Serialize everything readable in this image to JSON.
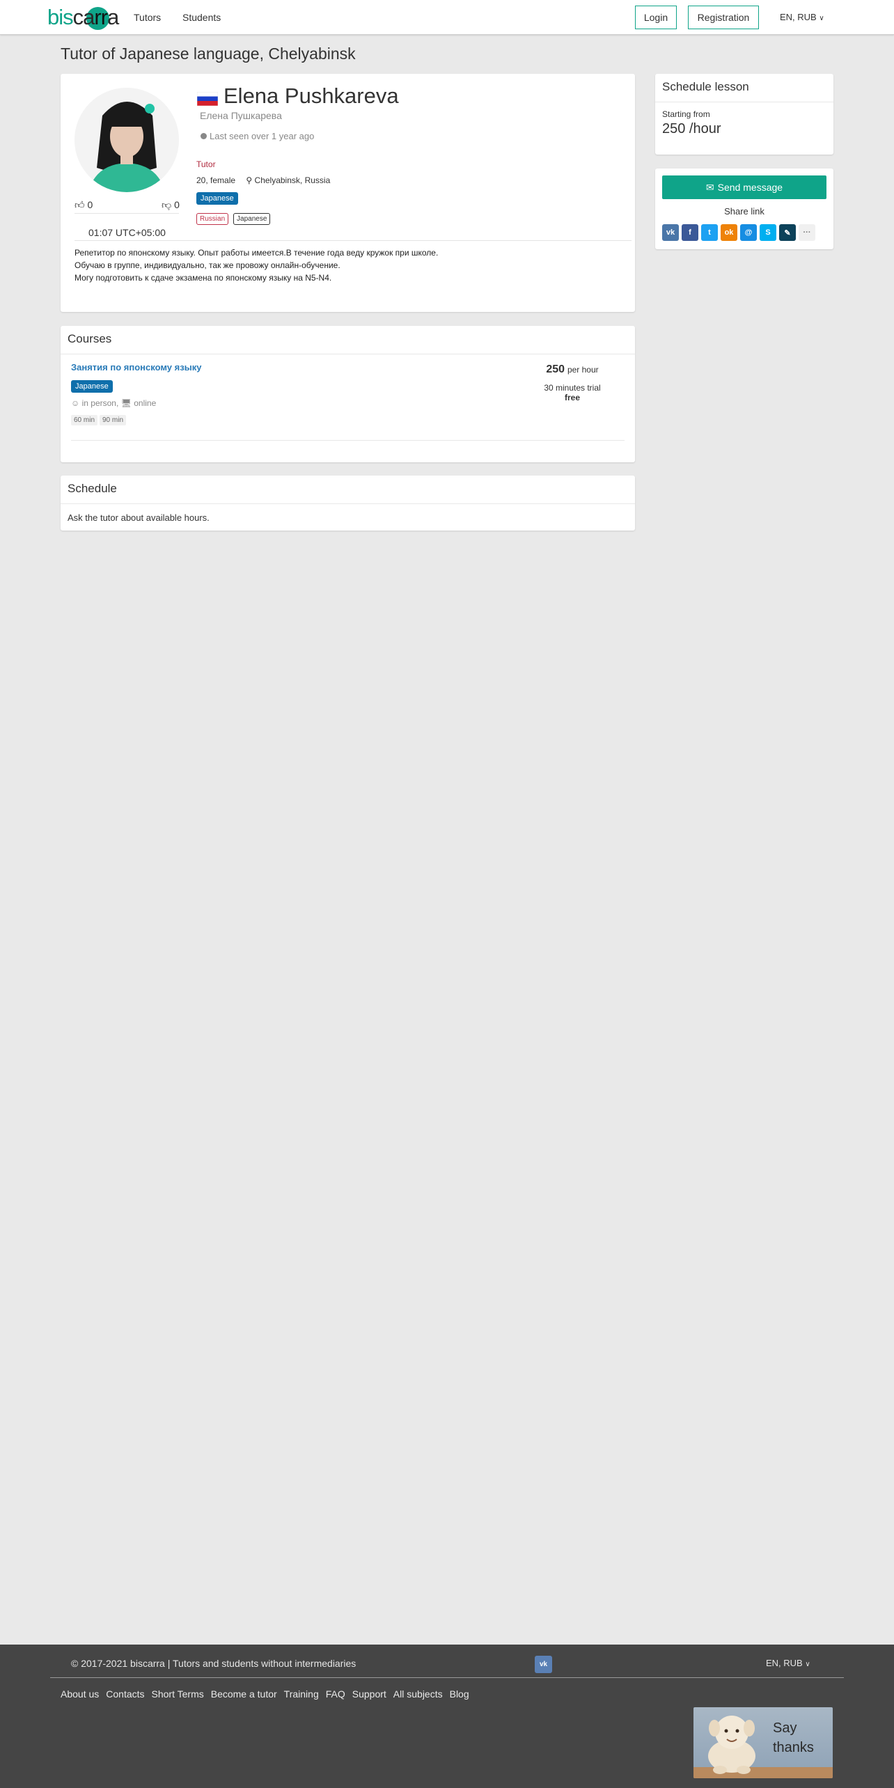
{
  "nav": {
    "logo_text": "biscarra",
    "links": [
      "Tutors",
      "Students"
    ],
    "login": "Login",
    "registration": "Registration",
    "lang": "EN, RUB"
  },
  "page_title": "Tutor of Japanese language, Chelyabinsk",
  "profile": {
    "name": "Elena Pushkareva",
    "native_name": "Елена Пушкарева",
    "last_seen": "Last seen over 1 year ago",
    "likes": "0",
    "dislikes": "0",
    "local_time": "01:07 UTC+05:00",
    "role": "Tutor",
    "age_gender": "20, female",
    "location": "Chelyabinsk, Russia",
    "subject_badge": "Japanese",
    "languages": [
      "Russian",
      "Japanese"
    ],
    "bio": [
      "Репетитор по японскому языку. Опыт работы имеется.В течение года веду кружок при школе.",
      "Обучаю в группе, индивидуально, так же провожу онлайн-обучение.",
      "Могу подготовить к сдаче экзамена по японскому языку на N5-N4."
    ]
  },
  "courses": {
    "heading": "Courses",
    "items": [
      {
        "title": "Занятия по японскому языку",
        "badge": "Japanese",
        "mode_inperson": "in person,",
        "mode_online": "online",
        "durations": [
          "60 min",
          "90 min"
        ],
        "price": "250",
        "currency_glyph": "",
        "price_unit": "per hour",
        "trial": "30 minutes trial",
        "trial_price": "free"
      }
    ]
  },
  "schedule": {
    "heading": "Schedule",
    "text": "Ask the tutor about available hours."
  },
  "lesson_card": {
    "heading": "Schedule lesson",
    "starting": "Starting from",
    "price": "250 /hour"
  },
  "contact_card": {
    "send": "Send message",
    "share_label": "Share link",
    "share_icons": [
      {
        "name": "vk-icon",
        "glyph": "vk",
        "color": "#4a76a8"
      },
      {
        "name": "facebook-icon",
        "glyph": "f",
        "color": "#3b5998"
      },
      {
        "name": "twitter-icon",
        "glyph": "t",
        "color": "#1da1f2"
      },
      {
        "name": "odnoklassniki-icon",
        "glyph": "ok",
        "color": "#ee8208"
      },
      {
        "name": "mailru-icon",
        "glyph": "@",
        "color": "#168de2"
      },
      {
        "name": "skype-icon",
        "glyph": "S",
        "color": "#00aff0"
      },
      {
        "name": "livejournal-icon",
        "glyph": "✎",
        "color": "#0d425a"
      },
      {
        "name": "more-icon",
        "glyph": "···",
        "color": "#f0f0f0"
      }
    ]
  },
  "footer": {
    "copyright": "© 2017-2021 biscarra | Tutors and students without intermediaries",
    "lang": "EN, RUB",
    "links": [
      "About us",
      "Contacts",
      "Short Terms",
      "Become a tutor",
      "Training",
      "FAQ",
      "Support",
      "All subjects",
      "Blog"
    ],
    "thanks_line1": "Say",
    "thanks_line2": "thanks"
  },
  "colors": {
    "brand": "#0fa489",
    "badge_blue": "#0f6fab",
    "link_blue": "#2a7bb8",
    "tutor_red": "#b02a3e",
    "footer_bg": "#454545"
  }
}
